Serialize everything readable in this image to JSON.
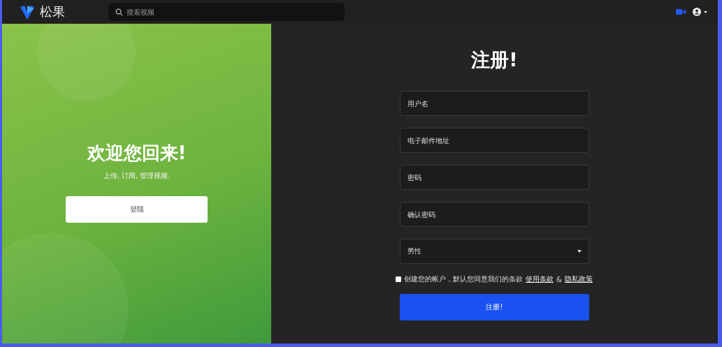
{
  "header": {
    "logo_text": "松果",
    "search": {
      "placeholder": "搜索视频"
    }
  },
  "welcome": {
    "title": "欢迎您回来!",
    "subtitle": "上传, 订阅, 管理视频.",
    "login_button": "登陆"
  },
  "register": {
    "title": "注册!",
    "fields": [
      {
        "kind": "text",
        "placeholder": "用户名"
      },
      {
        "kind": "text",
        "placeholder": "电子邮件地址"
      },
      {
        "kind": "password",
        "placeholder": "密码"
      },
      {
        "kind": "password",
        "placeholder": "确认密码"
      },
      {
        "kind": "select",
        "value": "男性"
      }
    ],
    "agreement": {
      "checked": false,
      "text": "创建您的帐户，默认您同意我们的条款",
      "terms_link": "使用条款",
      "separator": "&",
      "privacy_link": "隐私政策"
    },
    "submit_button": "注册!"
  }
}
